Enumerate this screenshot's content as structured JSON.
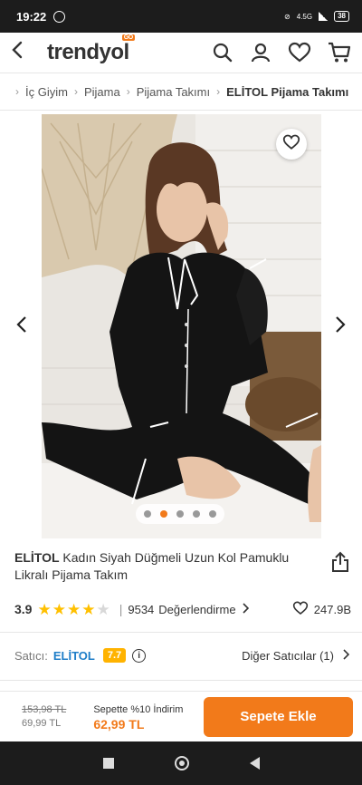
{
  "status_bar": {
    "time": "19:22",
    "network": "4.5G",
    "battery": "38"
  },
  "header": {
    "logo": "trendyol",
    "logo_badge": "GO"
  },
  "breadcrumb": [
    "İç Giyim",
    "Pijama",
    "Pijama Takımı",
    "ELİTOL Pijama Takımı"
  ],
  "gallery": {
    "image_count": 5,
    "active_index": 1
  },
  "product": {
    "brand": "ELİTOL",
    "name": "Kadın Siyah Düğmeli Uzun Kol Pamuklu Likralı Pijama Takım",
    "rating": "3.9",
    "rating_value": 3.9,
    "review_count": "9534",
    "review_label": "Değerlendirme",
    "likes": "247.9B"
  },
  "seller": {
    "label": "Satıcı:",
    "name": "ELİTOL",
    "score": "7.7",
    "other_sellers": "Diğer Satıcılar (1)"
  },
  "pricing": {
    "old_price": "153,98 TL",
    "price": "69,99 TL",
    "promo_label": "Sepette %10 İndirim",
    "promo_price": "62,99 TL",
    "add_to_cart": "Sepete Ekle"
  },
  "colors": {
    "accent": "#f27a1a",
    "seller_link": "#1e7ec8",
    "score_badge": "#ffb300",
    "star": "#ffc000"
  }
}
